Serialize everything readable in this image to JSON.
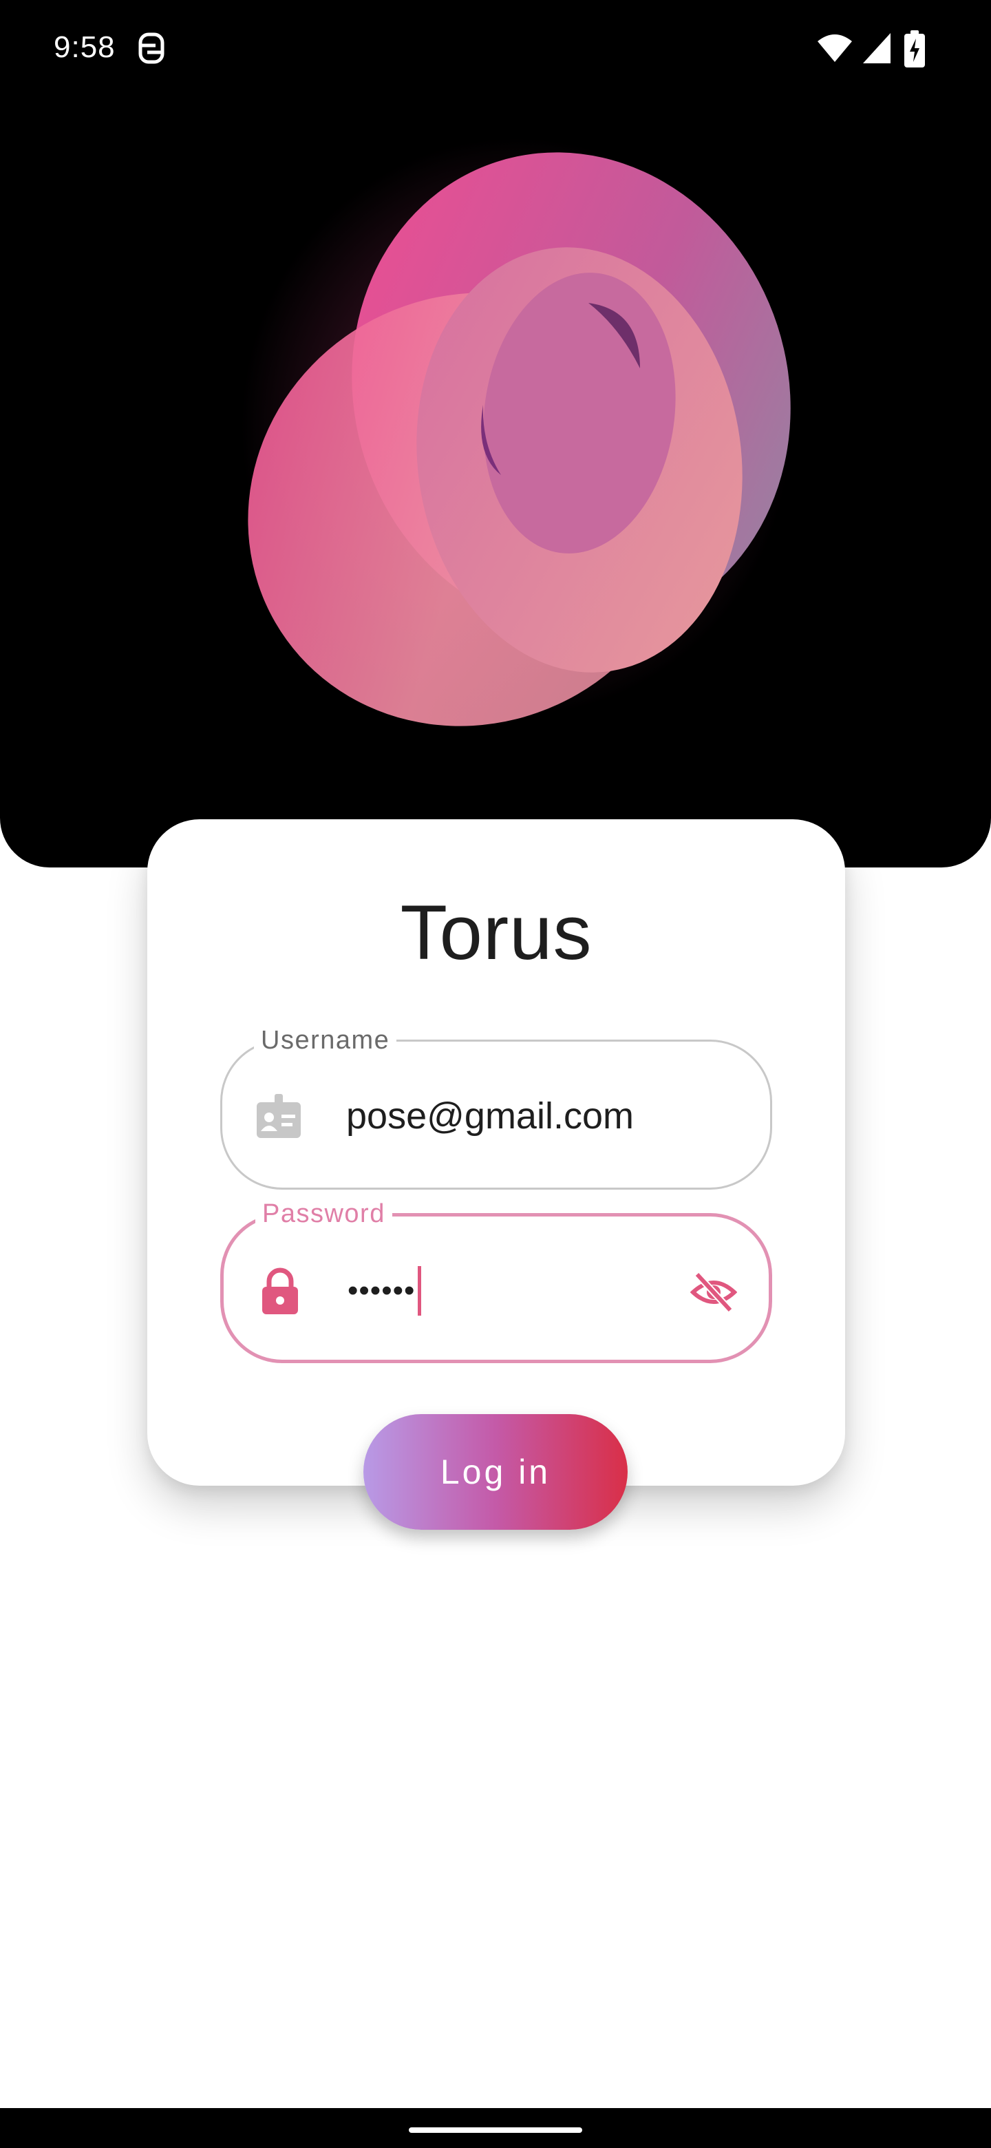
{
  "status_bar": {
    "time": "9:58",
    "icons": [
      "nfc-icon",
      "wifi-icon",
      "cell-signal-icon",
      "battery-charging-icon"
    ]
  },
  "hero": {
    "artwork": "torus-logo",
    "colors": {
      "primary": "#ee4d91",
      "secondary": "#9b84a4"
    }
  },
  "app": {
    "title": "Torus"
  },
  "form": {
    "username": {
      "label": "Username",
      "value": "pose@gmail.com",
      "icon": "id-badge-icon"
    },
    "password": {
      "label": "Password",
      "value": "••••••",
      "icon": "lock-icon",
      "toggle_icon": "visibility-off-icon",
      "focused": true
    }
  },
  "actions": {
    "login_label": "Log in"
  },
  "theme": {
    "accent": "#e0577f",
    "gradient_start": "#b89ae6",
    "gradient_end": "#d92f48"
  }
}
